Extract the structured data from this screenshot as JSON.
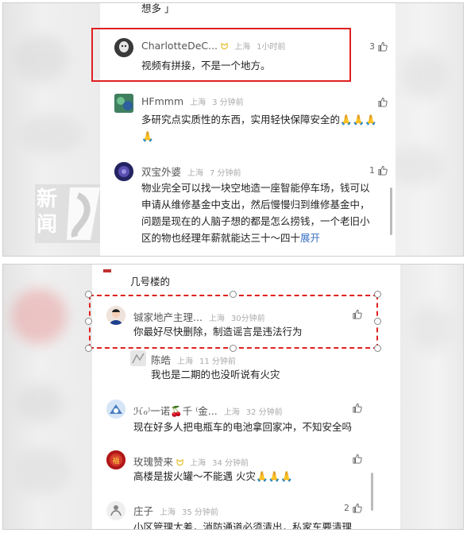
{
  "top": {
    "cut_text": "想多 」",
    "comments": [
      {
        "user": "CharlotteDeC...",
        "location": "上海",
        "time": "1小时前",
        "likes": "3",
        "text": "视频有拼接，不是一个地方。"
      },
      {
        "user": "HFmmm",
        "location": "上海",
        "time": "3 分钟前",
        "likes": "",
        "text": "多研究点实质性的东西，实用轻快保障安全的🙏🙏🙏🙏"
      },
      {
        "user": "双宝外婆",
        "location": "上海",
        "time": "7 分钟前",
        "likes": "1",
        "text": "物业完全可以找一块空地造一座智能停车场，钱可以申请从维修基金中支出，然后慢慢归到维修基金中，问题是现在的人脑子想的都是怎么捞钱，一个老旧小区的物也经理年薪就能达三十～四十",
        "more": "展开"
      }
    ],
    "watermark": {
      "line1": "新",
      "line2": "闻"
    }
  },
  "bottom": {
    "cut_text": "几号楼的",
    "comments": [
      {
        "user": "铖家地产主理...",
        "location": "上海",
        "time": "30分钟前",
        "likes": "",
        "text": "你最好尽快删除，制造谣言是违法行为"
      },
      {
        "user": "陈皓",
        "location": "上海",
        "time": "11 分钟前",
        "likes": "",
        "text": "我也是二期的也没听说有火灾"
      },
      {
        "user": "ℋℴ⁾一诺🍒千 ⁽金...",
        "location": "上海",
        "time": "32 分钟前",
        "likes": "",
        "text": "现在好多人把电瓶车的电池拿回家冲，不知安全吗"
      },
      {
        "user": "玫瑰赞来",
        "location": "上海",
        "time": "34 分钟前",
        "likes": "",
        "text": "高楼是拔火罐～不能遇 火灾🙏🙏🙏"
      },
      {
        "user": "庄子",
        "location": "上海",
        "time": "35 分钟前",
        "likes": "2",
        "text": "小区管理太差，消防通道必须清出，私家车要清理"
      }
    ]
  },
  "colors": {
    "highlight": "#e02020",
    "link": "#3a6fc4",
    "meta": "#aaaaaa"
  }
}
